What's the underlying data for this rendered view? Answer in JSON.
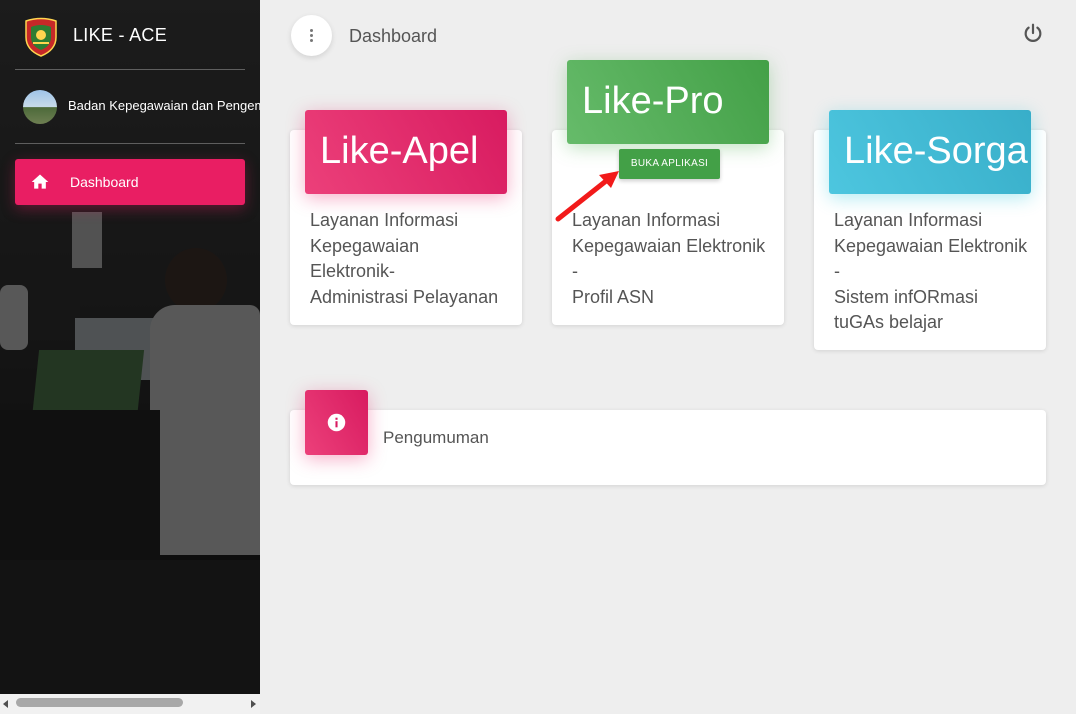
{
  "app": {
    "title": "LIKE - ACE",
    "logo_icon": "regency-crest-icon"
  },
  "sidebar": {
    "user_name": "Badan Kepegawaian dan Pengembangan",
    "nav": [
      {
        "label": "Dashboard",
        "icon": "home-icon",
        "active": true
      }
    ],
    "accent": "#e91e63"
  },
  "header": {
    "title": "Dashboard",
    "menu_icon": "more-vert-icon",
    "logout_icon": "power-icon"
  },
  "cards": [
    {
      "title": "Like-Apel",
      "color": "#e91e63",
      "lines": [
        "Layanan Informasi",
        "Kepegawaian",
        "Elektronik-",
        "Administrasi Pelayanan"
      ]
    },
    {
      "title": "Like-Pro",
      "color": "#4caf50",
      "button": "BUKA APLIKASI",
      "lines": [
        "Layanan Informasi",
        "Kepegawaian Elektronik",
        "-",
        "Profil ASN"
      ]
    },
    {
      "title": "Like-Sorga",
      "color": "#26c6da",
      "lines": [
        "Layanan Informasi",
        "Kepegawaian Elektronik",
        "-",
        "Sistem infORmasi",
        "tuGAs belajar"
      ]
    }
  ],
  "announcement": {
    "label": "Pengumuman",
    "icon": "info-icon"
  }
}
